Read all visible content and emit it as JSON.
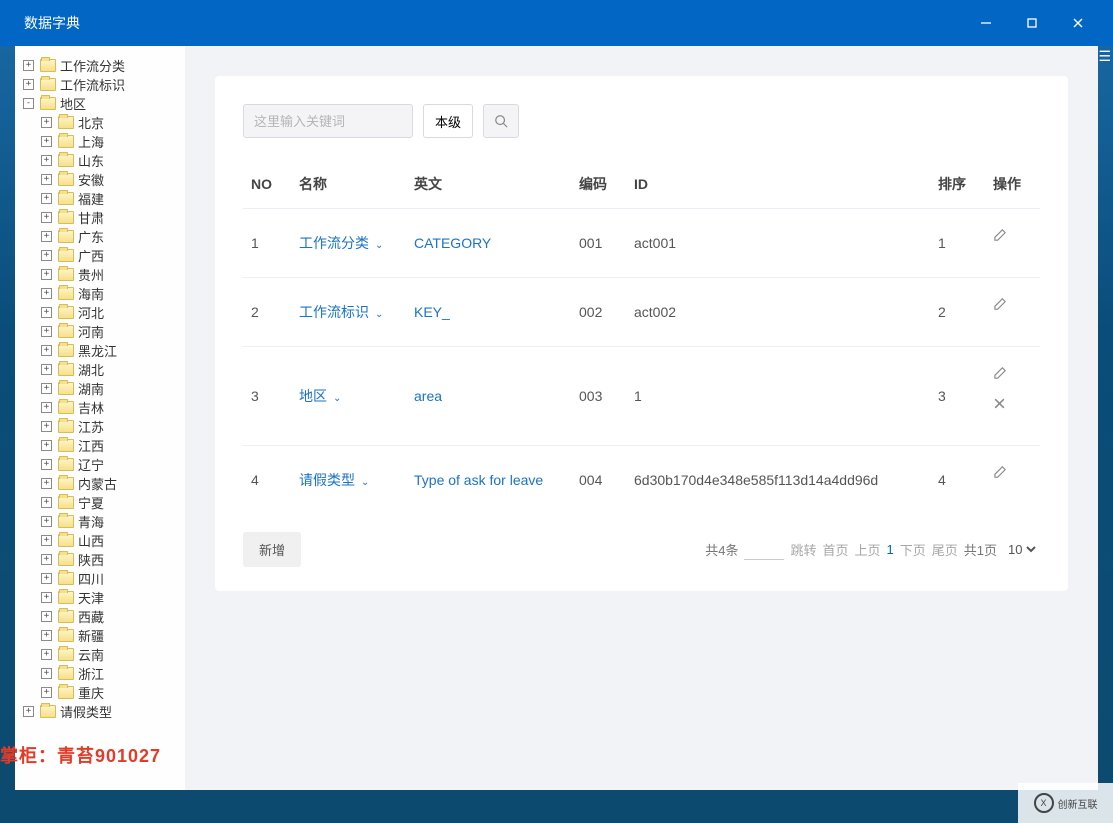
{
  "window": {
    "title": "数据字典"
  },
  "tree": {
    "root": [
      {
        "label": "工作流分类",
        "expanded": false
      },
      {
        "label": "工作流标识",
        "expanded": false
      },
      {
        "label": "地区",
        "expanded": true,
        "children": [
          {
            "label": "北京"
          },
          {
            "label": "上海"
          },
          {
            "label": "山东"
          },
          {
            "label": "安徽"
          },
          {
            "label": "福建"
          },
          {
            "label": "甘肃"
          },
          {
            "label": "广东"
          },
          {
            "label": "广西"
          },
          {
            "label": "贵州"
          },
          {
            "label": "海南"
          },
          {
            "label": "河北"
          },
          {
            "label": "河南"
          },
          {
            "label": "黑龙江"
          },
          {
            "label": "湖北"
          },
          {
            "label": "湖南"
          },
          {
            "label": "吉林"
          },
          {
            "label": "江苏"
          },
          {
            "label": "江西"
          },
          {
            "label": "辽宁"
          },
          {
            "label": "内蒙古"
          },
          {
            "label": "宁夏"
          },
          {
            "label": "青海"
          },
          {
            "label": "山西"
          },
          {
            "label": "陕西"
          },
          {
            "label": "四川"
          },
          {
            "label": "天津"
          },
          {
            "label": "西藏"
          },
          {
            "label": "新疆"
          },
          {
            "label": "云南"
          },
          {
            "label": "浙江"
          },
          {
            "label": "重庆"
          }
        ]
      },
      {
        "label": "请假类型",
        "expanded": false
      }
    ]
  },
  "search": {
    "placeholder": "这里输入关键词",
    "level_label": "本级"
  },
  "table": {
    "headers": {
      "no": "NO",
      "name": "名称",
      "en": "英文",
      "code": "编码",
      "id": "ID",
      "sort": "排序",
      "op": "操作"
    },
    "rows": [
      {
        "no": "1",
        "name": "工作流分类",
        "en": "CATEGORY",
        "code": "001",
        "id": "act001",
        "sort": "1",
        "deletable": false
      },
      {
        "no": "2",
        "name": "工作流标识",
        "en": "KEY_",
        "code": "002",
        "id": "act002",
        "sort": "2",
        "deletable": false
      },
      {
        "no": "3",
        "name": "地区",
        "en": "area",
        "code": "003",
        "id": "1",
        "sort": "3",
        "deletable": true
      },
      {
        "no": "4",
        "name": "请假类型",
        "en": "Type of ask for leave",
        "code": "004",
        "id": "6d30b170d4e348e585f113d14a4dd96d",
        "sort": "4",
        "deletable": false
      }
    ]
  },
  "footer": {
    "add_label": "新增",
    "total_label": "共4条",
    "jump_label": "跳转",
    "first_label": "首页",
    "prev_label": "上页",
    "current_page": "1",
    "next_label": "下页",
    "last_label": "尾页",
    "pages_label": "共1页",
    "page_size": "10"
  },
  "watermark": "掌柜：青苔901027",
  "brand": "创新互联"
}
